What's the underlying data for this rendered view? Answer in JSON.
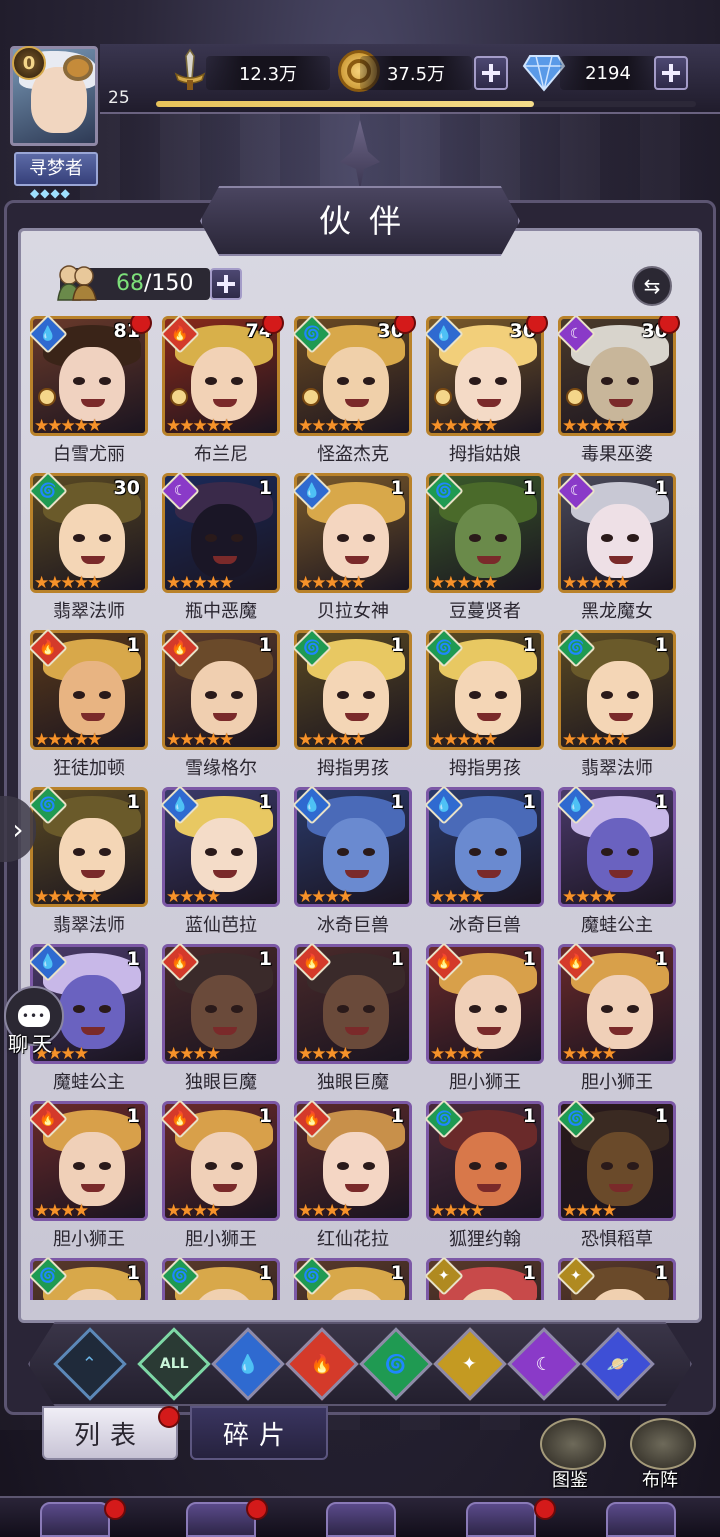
{
  "player": {
    "vip": "0",
    "level": "25",
    "xp_fraction": 0.7,
    "title": "寻梦者",
    "title_stars": "◆◆◆◆"
  },
  "resources": {
    "power": "12.3万",
    "gold": "37.5万",
    "gems": "2194"
  },
  "panel": {
    "title": "伙伴",
    "owned": "68",
    "capacity": "/150",
    "swap_icon": "⇆"
  },
  "heroes": [
    {
      "name": "白雪尤丽",
      "level": "81",
      "element": "water",
      "frame": "gold",
      "stars": 5,
      "dot": true,
      "badge": true,
      "colors": [
        "#6a3a2a",
        "#f0d2c0",
        "#3a2418"
      ]
    },
    {
      "name": "布兰尼",
      "level": "74",
      "element": "fire",
      "frame": "gold",
      "stars": 5,
      "dot": true,
      "badge": true,
      "colors": [
        "#8a2a1a",
        "#f2d2b6",
        "#d8b04a"
      ]
    },
    {
      "name": "怪盗杰克",
      "level": "30",
      "element": "wind",
      "frame": "gold",
      "stars": 5,
      "dot": true,
      "badge": true,
      "colors": [
        "#6a4a22",
        "#f0d0aa",
        "#d8a84a"
      ]
    },
    {
      "name": "拇指姑娘",
      "level": "30",
      "element": "water",
      "frame": "gold",
      "stars": 5,
      "dot": true,
      "badge": true,
      "colors": [
        "#7a5a2a",
        "#f4dac6",
        "#f2cf7a"
      ]
    },
    {
      "name": "毒果巫婆",
      "level": "30",
      "element": "dark",
      "frame": "gold",
      "stars": 5,
      "dot": true,
      "badge": true,
      "colors": [
        "#4a3a2a",
        "#c8b69a",
        "#d8d4cc"
      ]
    },
    {
      "name": "翡翠法师",
      "level": "30",
      "element": "wind",
      "frame": "gold",
      "stars": 5,
      "dot": false,
      "badge": false,
      "colors": [
        "#5a4a22",
        "#f4d6b6",
        "#6a5a2a"
      ]
    },
    {
      "name": "瓶中恶魔",
      "level": "1",
      "element": "dark",
      "frame": "gold",
      "stars": 5,
      "dot": false,
      "badge": false,
      "colors": [
        "#1a2a5a",
        "#1a1626",
        "#3a2a4a"
      ]
    },
    {
      "name": "贝拉女神",
      "level": "1",
      "element": "water",
      "frame": "gold",
      "stars": 5,
      "dot": false,
      "badge": false,
      "colors": [
        "#7a5a2a",
        "#f4d6c0",
        "#d8a84a"
      ]
    },
    {
      "name": "豆蔓贤者",
      "level": "1",
      "element": "wind",
      "frame": "gold",
      "stars": 5,
      "dot": false,
      "badge": false,
      "colors": [
        "#3a5a2a",
        "#6a8a4a",
        "#4a6a2a"
      ]
    },
    {
      "name": "黑龙魔女",
      "level": "1",
      "element": "dark",
      "frame": "gold",
      "stars": 5,
      "dot": false,
      "badge": false,
      "colors": [
        "#4a4a5a",
        "#eee0e6",
        "#c8c8d4"
      ]
    },
    {
      "name": "狂徒加顿",
      "level": "1",
      "element": "fire",
      "frame": "gold",
      "stars": 5,
      "dot": false,
      "badge": false,
      "colors": [
        "#5a3a1a",
        "#e8b482",
        "#d8a84a"
      ]
    },
    {
      "name": "雪缘格尔",
      "level": "1",
      "element": "fire",
      "frame": "gold",
      "stars": 5,
      "dot": false,
      "badge": false,
      "colors": [
        "#5a3a2a",
        "#f0cfb0",
        "#6a4a2a"
      ]
    },
    {
      "name": "拇指男孩",
      "level": "1",
      "element": "wind",
      "frame": "gold",
      "stars": 5,
      "dot": false,
      "badge": false,
      "colors": [
        "#5a4a22",
        "#f4d6b6",
        "#e8c862"
      ]
    },
    {
      "name": "拇指男孩",
      "level": "1",
      "element": "wind",
      "frame": "gold",
      "stars": 5,
      "dot": false,
      "badge": false,
      "colors": [
        "#5a4a22",
        "#f4d6b6",
        "#e8c862"
      ]
    },
    {
      "name": "翡翠法师",
      "level": "1",
      "element": "wind",
      "frame": "gold",
      "stars": 5,
      "dot": false,
      "badge": false,
      "colors": [
        "#5a4a22",
        "#f4d6b6",
        "#6a5a2a"
      ]
    },
    {
      "name": "翡翠法师",
      "level": "1",
      "element": "wind",
      "frame": "gold",
      "stars": 5,
      "dot": false,
      "badge": false,
      "colors": [
        "#5a4a22",
        "#f4d6b6",
        "#6a5a2a"
      ]
    },
    {
      "name": "蓝仙芭拉",
      "level": "1",
      "element": "water",
      "frame": "purple",
      "stars": 4,
      "dot": false,
      "badge": false,
      "colors": [
        "#3a3a6a",
        "#f4dcc8",
        "#e8c862"
      ]
    },
    {
      "name": "冰奇巨兽",
      "level": "1",
      "element": "water",
      "frame": "purple",
      "stars": 4,
      "dot": false,
      "badge": false,
      "colors": [
        "#2a3a6a",
        "#6a8ad0",
        "#4a6ab8"
      ]
    },
    {
      "name": "冰奇巨兽",
      "level": "1",
      "element": "water",
      "frame": "purple",
      "stars": 4,
      "dot": false,
      "badge": false,
      "colors": [
        "#2a3a6a",
        "#6a8ad0",
        "#4a6ab8"
      ]
    },
    {
      "name": "魔蛙公主",
      "level": "1",
      "element": "water",
      "frame": "purple",
      "stars": 4,
      "dot": false,
      "badge": false,
      "colors": [
        "#4a3a6a",
        "#6a62c0",
        "#c8b8e8"
      ]
    },
    {
      "name": "魔蛙公主",
      "level": "1",
      "element": "water",
      "frame": "purple",
      "stars": 4,
      "dot": false,
      "badge": false,
      "colors": [
        "#4a3a6a",
        "#6a62c0",
        "#c8b8e8"
      ]
    },
    {
      "name": "独眼巨魔",
      "level": "1",
      "element": "fire",
      "frame": "purple",
      "stars": 4,
      "dot": false,
      "badge": false,
      "colors": [
        "#4a2a2a",
        "#6a4a3a",
        "#3a2a2a"
      ]
    },
    {
      "name": "独眼巨魔",
      "level": "1",
      "element": "fire",
      "frame": "purple",
      "stars": 4,
      "dot": false,
      "badge": false,
      "colors": [
        "#4a2a2a",
        "#6a4a3a",
        "#3a2a2a"
      ]
    },
    {
      "name": "胆小狮王",
      "level": "1",
      "element": "fire",
      "frame": "purple",
      "stars": 4,
      "dot": false,
      "badge": false,
      "colors": [
        "#6a2a2a",
        "#f0d0b8",
        "#d8a04a"
      ]
    },
    {
      "name": "胆小狮王",
      "level": "1",
      "element": "fire",
      "frame": "purple",
      "stars": 4,
      "dot": false,
      "badge": false,
      "colors": [
        "#6a2a2a",
        "#f0d0b8",
        "#d8a04a"
      ]
    },
    {
      "name": "胆小狮王",
      "level": "1",
      "element": "fire",
      "frame": "purple",
      "stars": 4,
      "dot": false,
      "badge": false,
      "colors": [
        "#6a2a2a",
        "#f0d0b8",
        "#d8a04a"
      ]
    },
    {
      "name": "胆小狮王",
      "level": "1",
      "element": "fire",
      "frame": "purple",
      "stars": 4,
      "dot": false,
      "badge": false,
      "colors": [
        "#6a2a2a",
        "#f0d0b8",
        "#d8a04a"
      ]
    },
    {
      "name": "红仙花拉",
      "level": "1",
      "element": "fire",
      "frame": "purple",
      "stars": 4,
      "dot": false,
      "badge": false,
      "colors": [
        "#5a2a2a",
        "#f4d6c4",
        "#c8904a"
      ]
    },
    {
      "name": "狐狸约翰",
      "level": "1",
      "element": "wind",
      "frame": "purple",
      "stars": 4,
      "dot": false,
      "badge": false,
      "colors": [
        "#4a2a3a",
        "#d8784a",
        "#6a2a2a"
      ]
    },
    {
      "name": "恐惧稻草",
      "level": "1",
      "element": "wind",
      "frame": "purple",
      "stars": 4,
      "dot": false,
      "badge": false,
      "colors": [
        "#2a1a1a",
        "#6a4a2a",
        "#3a2a22"
      ]
    },
    {
      "name": "",
      "level": "1",
      "element": "wind",
      "frame": "purple",
      "stars": 4,
      "dot": false,
      "badge": false,
      "colors": [
        "#5a3a2a",
        "#f0d0b0",
        "#d8a84a"
      ]
    },
    {
      "name": "",
      "level": "1",
      "element": "wind",
      "frame": "purple",
      "stars": 4,
      "dot": false,
      "badge": false,
      "colors": [
        "#5a3a2a",
        "#f0d0b0",
        "#d8a84a"
      ]
    },
    {
      "name": "",
      "level": "1",
      "element": "wind",
      "frame": "purple",
      "stars": 4,
      "dot": false,
      "badge": false,
      "colors": [
        "#5a3a2a",
        "#f0d0b0",
        "#d8a84a"
      ]
    },
    {
      "name": "",
      "level": "1",
      "element": "light",
      "frame": "purple",
      "stars": 4,
      "dot": false,
      "badge": false,
      "colors": [
        "#5a3a2a",
        "#f0d0b0",
        "#c84a4a"
      ]
    },
    {
      "name": "",
      "level": "1",
      "element": "light",
      "frame": "purple",
      "stars": 4,
      "dot": false,
      "badge": false,
      "colors": [
        "#5a3a2a",
        "#f0d0b0",
        "#6a4a2a"
      ]
    }
  ],
  "element_glyphs": {
    "water": "💧",
    "fire": "🔥",
    "wind": "🌀",
    "dark": "☾",
    "light": "✦"
  },
  "element_colors": {
    "water": "#2f6ad0",
    "fire": "#d43a2a",
    "wind": "#1f9a52",
    "dark": "#8a3ac8",
    "light": "#b08a20"
  },
  "filters": [
    {
      "id": "shield",
      "label": "⌃",
      "icon": "shield-icon"
    },
    {
      "id": "all",
      "label": "ALL",
      "icon": "all-icon"
    },
    {
      "id": "water",
      "label": "💧",
      "icon": "water-icon"
    },
    {
      "id": "fire",
      "label": "🔥",
      "icon": "fire-icon"
    },
    {
      "id": "wind",
      "label": "🌀",
      "icon": "wind-icon"
    },
    {
      "id": "light",
      "label": "✦",
      "icon": "light-icon"
    },
    {
      "id": "dark",
      "label": "☾",
      "icon": "dark-icon"
    },
    {
      "id": "cosmic",
      "label": "🪐",
      "icon": "planet-icon"
    }
  ],
  "tabs": {
    "list": "列表",
    "shards": "碎片"
  },
  "side": {
    "codex": "图鉴",
    "formation": "布阵"
  },
  "chat": {
    "bubble": "•••",
    "label": "聊天"
  },
  "left_arrow": "›"
}
